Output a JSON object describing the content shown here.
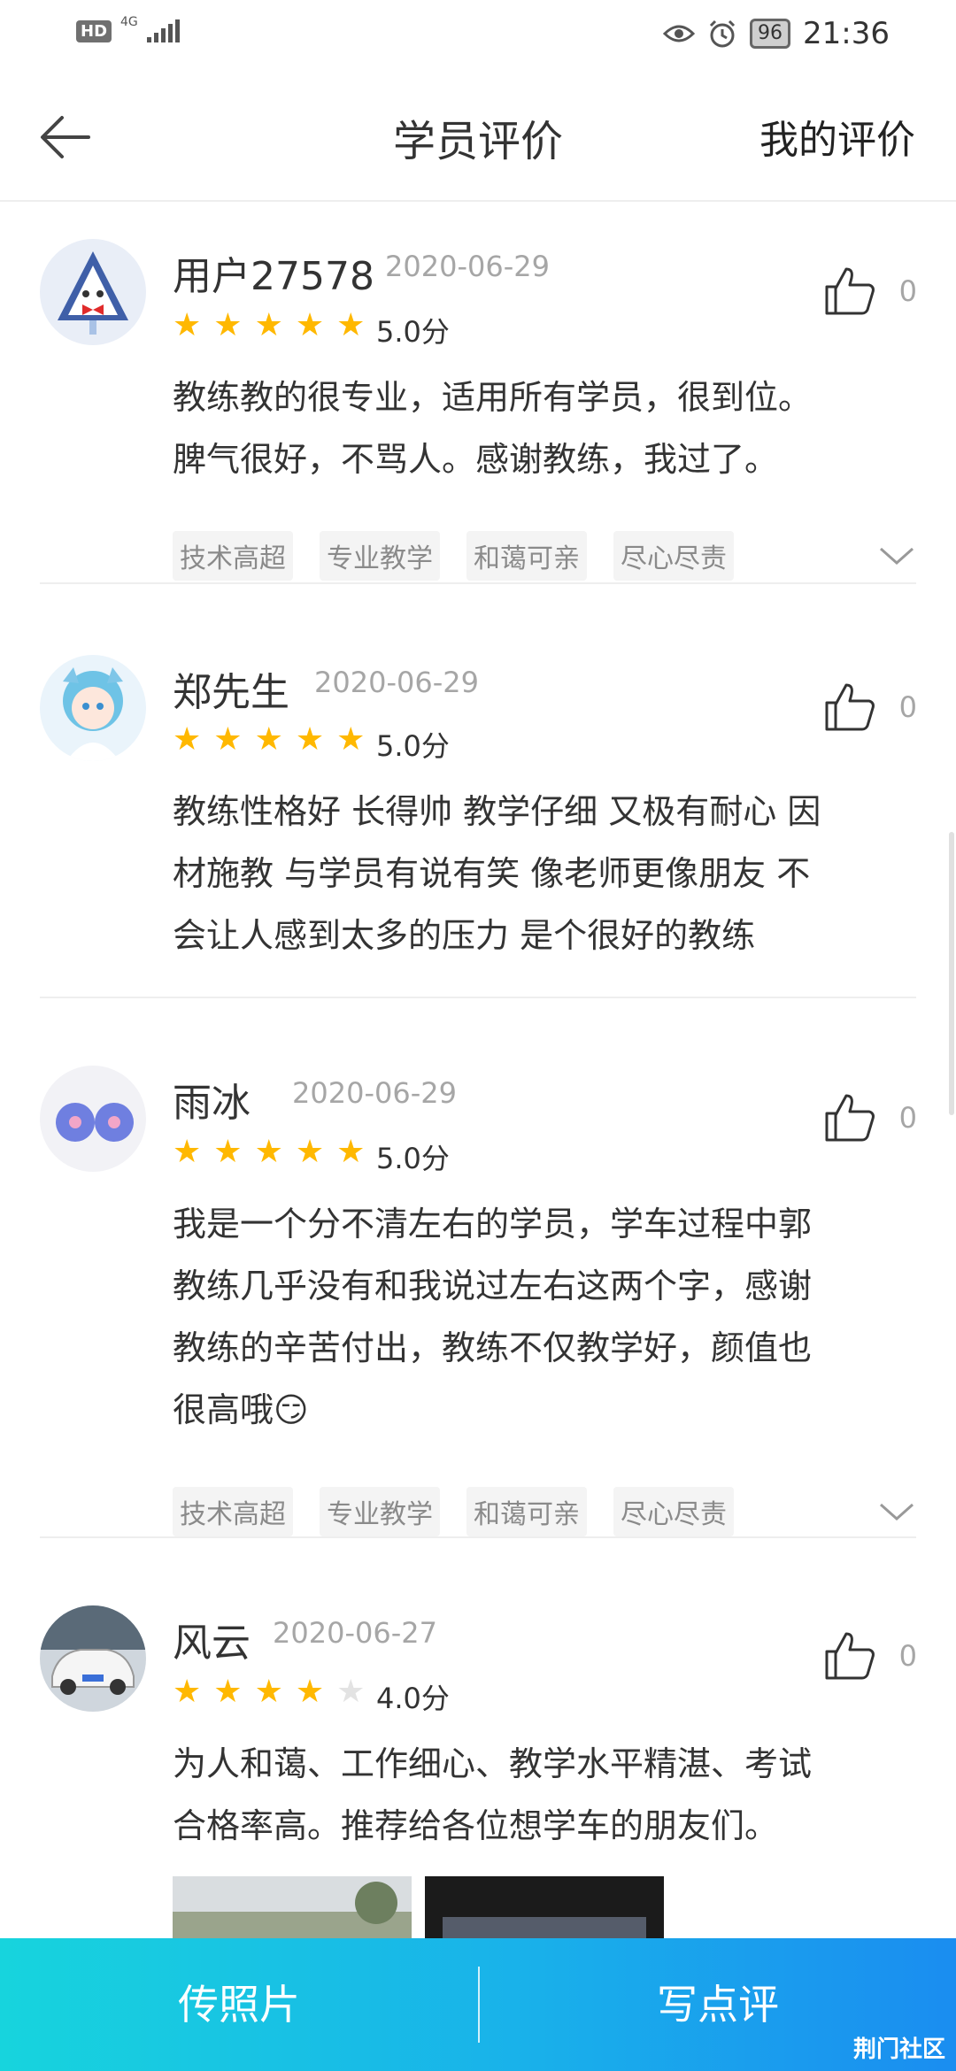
{
  "status_bar": {
    "hd": "HD",
    "network": "4G",
    "battery": "96",
    "time": "21:36"
  },
  "header": {
    "title": "学员评价",
    "right_action": "我的评价"
  },
  "reviews": [
    {
      "name": "用户27578",
      "date": "2020-06-29",
      "rating": 5,
      "score": "5.0分",
      "likes": "0",
      "content_lines": [
        "教练教的很专业，适用所有学员，很到位。",
        "脾气很好，不骂人。感谢教练，我过了。"
      ],
      "tags": [
        "技术高超",
        "专业教学",
        "和蔼可亲",
        "尽心尽责"
      ]
    },
    {
      "name": "郑先生",
      "date": "2020-06-29",
      "rating": 5,
      "score": "5.0分",
      "likes": "0",
      "content_lines": [
        "教练性格好 长得帅 教学仔细 又极有耐心  因",
        "材施教 与学员有说有笑 像老师更像朋友 不",
        "会让人感到太多的压力 是个很好的教练"
      ],
      "tags": []
    },
    {
      "name": "雨冰",
      "date": "2020-06-29",
      "rating": 5,
      "score": "5.0分",
      "likes": "0",
      "content_lines": [
        "我是一个分不清左右的学员，学车过程中郭",
        "教练几乎没有和我说过左右这两个字，感谢",
        "教练的辛苦付出，教练不仅教学好，颜值也",
        "很高哦😏"
      ],
      "tags": [
        "技术高超",
        "专业教学",
        "和蔼可亲",
        "尽心尽责"
      ]
    },
    {
      "name": "风云",
      "date": "2020-06-27",
      "rating": 4,
      "score": "4.0分",
      "likes": "0",
      "content_lines": [
        "为人和蔼、工作细心、教学水平精湛、考试",
        "合格率高。推荐给各位想学车的朋友们。"
      ],
      "tags": []
    }
  ],
  "bottom_bar": {
    "upload_photo": "传照片",
    "write_review": "写点评",
    "watermark": "荆门社区"
  },
  "colors": {
    "star_on": "#ffb800",
    "star_off": "#e3e3e3",
    "bottom_gradient_start": "#17d4dd",
    "bottom_gradient_end": "#1a8df0"
  }
}
